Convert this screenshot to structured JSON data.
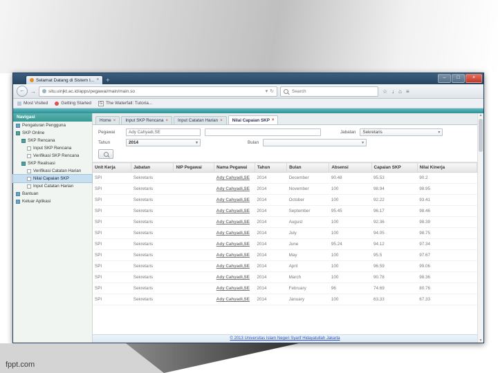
{
  "slide": {
    "watermark": "fppt.com"
  },
  "icons": {
    "plus": "+",
    "min": "–",
    "max": "□",
    "close": "×",
    "back": "←",
    "forward": "→",
    "reload": "↻",
    "caret": "▾",
    "star": "☆",
    "down": "↓",
    "home": "⌂",
    "menu": "≡",
    "scroll_up": "▲",
    "scroll_down": "▼"
  },
  "browser": {
    "tab_title": "Selamat Datang di Sistem I...",
    "url": "situ.uinjkt.ac.id/apps/pegawai/main/main.so",
    "search_placeholder": "Search",
    "bookmarks": [
      {
        "label": "Most Visited",
        "icon": "grid"
      },
      {
        "label": "Getting Started",
        "icon": "flame"
      },
      {
        "label": "The Waterfall: Tutoria...",
        "icon": "g-box"
      }
    ]
  },
  "sidebar": {
    "title": "Navigasi",
    "items": [
      {
        "label": "Pengaturan Pengguna",
        "level": 0,
        "icon": "folder",
        "selected": false
      },
      {
        "label": "SKP Online",
        "level": 0,
        "icon": "collapse",
        "selected": false
      },
      {
        "label": "SKP Rencana",
        "level": 1,
        "icon": "collapse",
        "selected": false
      },
      {
        "label": "Input SKP Rencana",
        "level": 2,
        "icon": "page",
        "selected": false
      },
      {
        "label": "Verifikasi SKP Rencana",
        "level": 2,
        "icon": "page",
        "selected": false
      },
      {
        "label": "SKP Realisasi",
        "level": 1,
        "icon": "collapse",
        "selected": false
      },
      {
        "label": "Verifikasi Catatan Harian",
        "level": 2,
        "icon": "page",
        "selected": false
      },
      {
        "label": "Nilai Capaian SKP",
        "level": 2,
        "icon": "page",
        "selected": true
      },
      {
        "label": "Input Catatan Harian",
        "level": 2,
        "icon": "page",
        "selected": false
      },
      {
        "label": "Bantuan",
        "level": 0,
        "icon": "folder",
        "selected": false
      },
      {
        "label": "Keluar Aplikasi",
        "level": 0,
        "icon": "folder",
        "selected": false
      }
    ]
  },
  "page_tabs": [
    {
      "label": "Home",
      "active": false
    },
    {
      "label": "Input SKP Rencana",
      "active": false
    },
    {
      "label": "Input Catatan Harian",
      "active": false
    },
    {
      "label": "Nilai Capaian SKP",
      "active": true
    }
  ],
  "filters": {
    "pegawai_label": "Pegawai",
    "pegawai_value": "Ady Cahyadi,SE",
    "nip_value": "",
    "jabatan_label": "Jabatan",
    "jabatan_value": "Sekretaris",
    "tahun_label": "Tahun",
    "tahun_value": "2014",
    "bulan_label": "Bulan",
    "bulan_value": ""
  },
  "table": {
    "columns": [
      "Unit Kerja",
      "Jabatan",
      "NIP Pegawai",
      "Nama Pegawai",
      "Tahun",
      "Bulan",
      "Absensi",
      "Capaian SKP",
      "Nilai Kinerja"
    ],
    "rows": [
      {
        "unit": "SPI",
        "jabatan": "Sekretaris",
        "nip": "",
        "nama": "Ady Cahyadi,SE",
        "tahun": "2014",
        "bulan": "December",
        "absensi": "90.48",
        "capaian": "95.53",
        "nilai": "90.2"
      },
      {
        "unit": "SPI",
        "jabatan": "Sekretaris",
        "nip": "",
        "nama": "Ady Cahyadi,SE",
        "tahun": "2014",
        "bulan": "November",
        "absensi": "100",
        "capaian": "98.94",
        "nilai": "98.95"
      },
      {
        "unit": "SPI",
        "jabatan": "Sekretaris",
        "nip": "",
        "nama": "Ady Cahyadi,SE",
        "tahun": "2014",
        "bulan": "October",
        "absensi": "100",
        "capaian": "92.22",
        "nilai": "93.41"
      },
      {
        "unit": "SPI",
        "jabatan": "Sekretaris",
        "nip": "",
        "nama": "Ady Cahyadi,SE",
        "tahun": "2014",
        "bulan": "September",
        "absensi": "95.45",
        "capaian": "96.17",
        "nilai": "98.46"
      },
      {
        "unit": "SPI",
        "jabatan": "Sekretaris",
        "nip": "",
        "nama": "Ady Cahyadi,SE",
        "tahun": "2014",
        "bulan": "August",
        "absensi": "100",
        "capaian": "92.36",
        "nilai": "98.39"
      },
      {
        "unit": "SPI",
        "jabatan": "Sekretaris",
        "nip": "",
        "nama": "Ady Cahyadi,SE",
        "tahun": "2014",
        "bulan": "July",
        "absensi": "100",
        "capaian": "94.05",
        "nilai": "98.75"
      },
      {
        "unit": "SPI",
        "jabatan": "Sekretaris",
        "nip": "",
        "nama": "Ady Cahyadi,SE",
        "tahun": "2014",
        "bulan": "June",
        "absensi": "95.24",
        "capaian": "94.12",
        "nilai": "97.34"
      },
      {
        "unit": "SPI",
        "jabatan": "Sekretaris",
        "nip": "",
        "nama": "Ady Cahyadi,SE",
        "tahun": "2014",
        "bulan": "May",
        "absensi": "100",
        "capaian": "95.5",
        "nilai": "97.67"
      },
      {
        "unit": "SPI",
        "jabatan": "Sekretaris",
        "nip": "",
        "nama": "Ady Cahyadi,SE",
        "tahun": "2014",
        "bulan": "April",
        "absensi": "100",
        "capaian": "96.59",
        "nilai": "99.06"
      },
      {
        "unit": "SPI",
        "jabatan": "Sekretaris",
        "nip": "",
        "nama": "Ady Cahyadi,SE",
        "tahun": "2014",
        "bulan": "March",
        "absensi": "100",
        "capaian": "90.78",
        "nilai": "98.36"
      },
      {
        "unit": "SPI",
        "jabatan": "Sekretaris",
        "nip": "",
        "nama": "Ady Cahyadi,SE",
        "tahun": "2014",
        "bulan": "February",
        "absensi": "96",
        "capaian": "74.69",
        "nilai": "80.76"
      },
      {
        "unit": "SPI",
        "jabatan": "Sekretaris",
        "nip": "",
        "nama": "Ady Cahyadi,SE",
        "tahun": "2014",
        "bulan": "January",
        "absensi": "100",
        "capaian": "63.33",
        "nilai": "67.33"
      }
    ]
  },
  "footer": {
    "text": "© 2013 Universitas Islam Negeri Syarif Hidayatullah Jakarta"
  }
}
